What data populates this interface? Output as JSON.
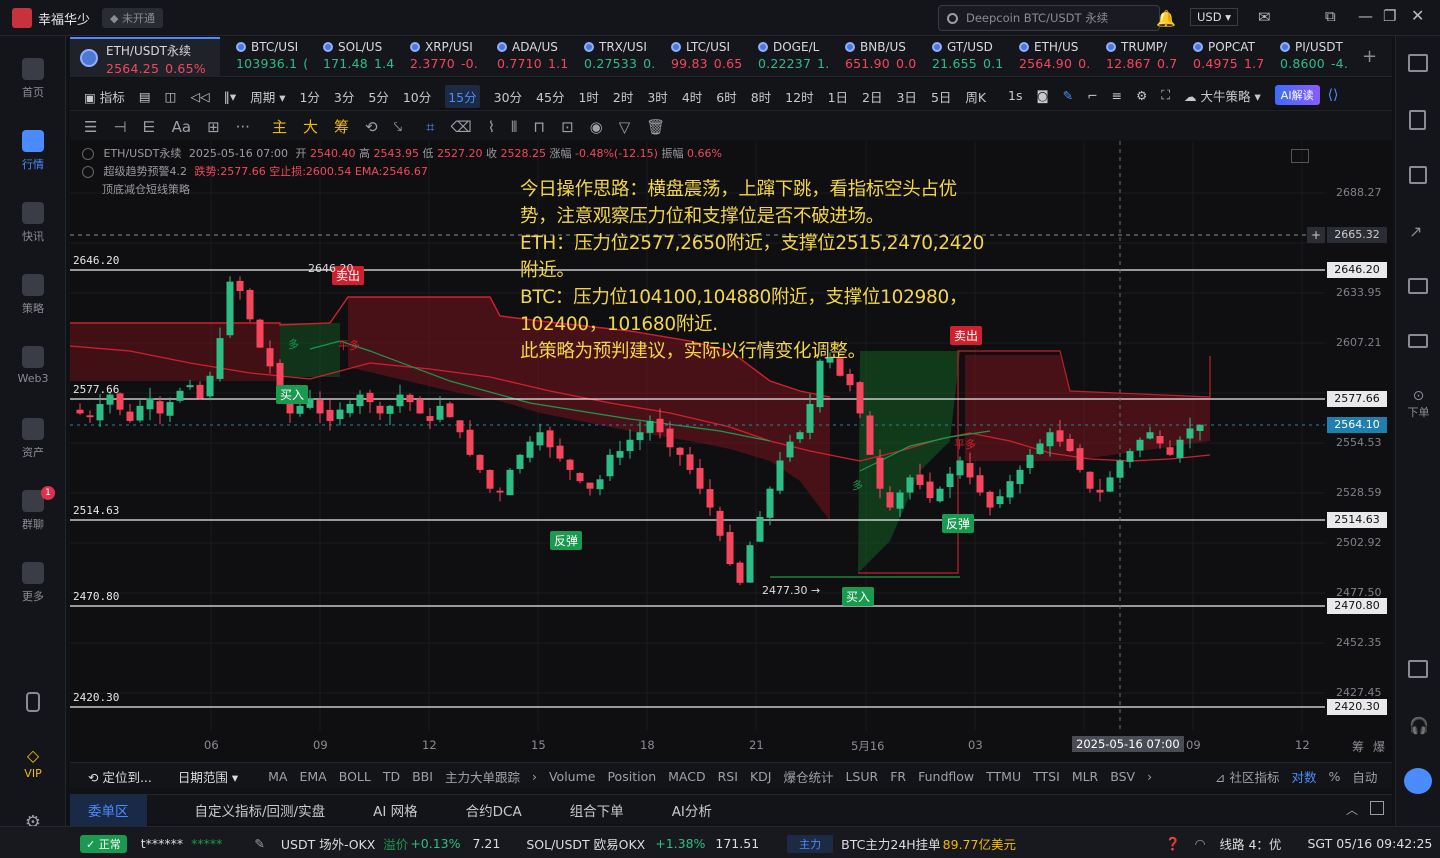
{
  "app": {
    "title": "幸福华少",
    "status": "未开通",
    "search_placeholder": "Deepcoin BTC/USDT 永续",
    "currency": "USD"
  },
  "sidebar": [
    {
      "label": "首页",
      "icon": "home-icon"
    },
    {
      "label": "行情",
      "icon": "market-chart-icon",
      "active": true
    },
    {
      "label": "快讯",
      "icon": "news-icon"
    },
    {
      "label": "策略",
      "icon": "strategy-icon"
    },
    {
      "label": "Web3",
      "icon": "web3-icon"
    },
    {
      "label": "资产",
      "icon": "wallet-icon"
    },
    {
      "label": "群聊",
      "icon": "chat-icon",
      "badge": "1"
    },
    {
      "label": "更多",
      "icon": "more-grid-icon"
    }
  ],
  "sidebar_bottom": {
    "vip": "VIP"
  },
  "rightbar": {
    "order_label": "下单"
  },
  "tickers": [
    {
      "name": "ETH/USDT永续",
      "price": "2564.25",
      "change": "0.65%",
      "dir": "dn",
      "active": true
    },
    {
      "name": "BTC/USI",
      "price": "103936.1",
      "change": "(",
      "dir": "up"
    },
    {
      "name": "SOL/US",
      "price": "171.48",
      "change": "1.4",
      "dir": "up"
    },
    {
      "name": "XRP/USI",
      "price": "2.3770",
      "change": "-0.",
      "dir": "dn"
    },
    {
      "name": "ADA/US",
      "price": "0.7710",
      "change": "1.1",
      "dir": "dn"
    },
    {
      "name": "TRX/USI",
      "price": "0.27533",
      "change": "0.",
      "dir": "up"
    },
    {
      "name": "LTC/USI",
      "price": "99.83",
      "change": "0.65",
      "dir": "dn"
    },
    {
      "name": "DOGE/L",
      "price": "0.22237",
      "change": "1.",
      "dir": "up"
    },
    {
      "name": "BNB/US",
      "price": "651.90",
      "change": "0.0",
      "dir": "dn"
    },
    {
      "name": "GT/USD",
      "price": "21.655",
      "change": "0.1",
      "dir": "up"
    },
    {
      "name": "ETH/US",
      "price": "2564.90",
      "change": "0.",
      "dir": "dn"
    },
    {
      "name": "TRUMP/",
      "price": "12.867",
      "change": "0.7",
      "dir": "dn"
    },
    {
      "name": "POPCAT",
      "price": "0.4975",
      "change": "1.7",
      "dir": "dn"
    },
    {
      "name": "PI/USDT",
      "price": "0.8600",
      "change": "-4.",
      "dir": "up"
    }
  ],
  "periods": {
    "indicator_label": "指标",
    "cycle_label": "周期",
    "items": [
      "1分",
      "3分",
      "5分",
      "10分",
      "15分",
      "30分",
      "45分",
      "1时",
      "2时",
      "3时",
      "4时",
      "6时",
      "8时",
      "12时",
      "1日",
      "2日",
      "3日",
      "5日",
      "周K"
    ],
    "selected": "15分",
    "sec": "1s",
    "bull_bear": "大牛策略",
    "ai": "AI解读"
  },
  "drawtools": [
    "主",
    "大",
    "筹"
  ],
  "chart": {
    "header": {
      "symbol": "ETH/USDT永续",
      "datetime": "2025-05-16 07:00",
      "open_lbl": "开",
      "open": "2540.40",
      "high_lbl": "高",
      "high": "2543.95",
      "low_lbl": "低",
      "low": "2527.20",
      "close_lbl": "收",
      "close": "2528.25",
      "chg_lbl": "涨幅",
      "chg": "-0.48%(-12.15)",
      "amp_lbl": "振幅",
      "amp": "0.66%"
    },
    "ind1": {
      "name": "超级趋势预警4.2",
      "a": "跌势:2577.66",
      "b": "空止损:2600.54",
      "c": "EMA:2546.67"
    },
    "ind2": "顶底减仓短线策略",
    "note": [
      "今日操作思路：横盘震荡，上蹿下跳，看指标空头占优势，注意观察压力位和支撑位是否不破进场。",
      "ETH：压力位2577,2650附近，支撑位2515,2470,2420附近。",
      "BTC：压力位104100,104880附近，支撑位102980，102400，101680附近.",
      "此策略为预判建议，实际以行情变化调整。"
    ],
    "hlines": [
      "2646.20",
      "2577.66",
      "2514.63",
      "2470.80",
      "2420.30"
    ],
    "yaxis": [
      "2688.27",
      "2665.32",
      "2646.20",
      "2633.95",
      "2607.21",
      "2577.66",
      "2564.10",
      "2554.53",
      "2528.59",
      "2514.63",
      "2502.92",
      "2477.50",
      "2470.80",
      "2452.35",
      "2427.45",
      "2420.30"
    ],
    "xaxis": [
      "06",
      "09",
      "12",
      "15",
      "18",
      "21",
      "5月16",
      "03",
      "2025-05-16 07:00",
      "09",
      "12"
    ],
    "signals": {
      "buy": "买入",
      "sell": "卖出",
      "rebound": "反弹",
      "peak": "2646.20",
      "low": "2477.30 →",
      "short": "平多",
      "long": "多"
    },
    "axis_icons": [
      "筹",
      "爆"
    ]
  },
  "indicators": {
    "locate": "定位到...",
    "range": "日期范围",
    "items": [
      "MA",
      "EMA",
      "BOLL",
      "TD",
      "BBI",
      "主力大单跟踪",
      "Volume",
      "Position",
      "MACD",
      "RSI",
      "KDJ",
      "爆仓统计",
      "LSUR",
      "FR",
      "Fundflow",
      "TTMU",
      "TTSI",
      "MLR",
      "BSV"
    ],
    "community": "社区指标",
    "compare": "对数",
    "pct": "%",
    "auto": "自动"
  },
  "tabs": [
    "委单区",
    "自定义指标/回测/实盘",
    "AI 网格",
    "合约DCA",
    "组合下单",
    "AI分析"
  ],
  "status": {
    "state": "正常",
    "user": "t******",
    "stars": "*****",
    "quote1": "USDT 场外-OKX",
    "q1lbl": "溢价",
    "q1chg": "+0.13%",
    "q1val": "7.21",
    "quote2": "SOL/USDT 欧易OKX",
    "q2chg": "+1.38%",
    "q2val": "171.51",
    "main": "主力",
    "mainText": "BTC主力24H挂单",
    "mainVal": "89.77亿美元",
    "line": "线路 4：优",
    "time": "SGT 05/16 09:42:25"
  }
}
